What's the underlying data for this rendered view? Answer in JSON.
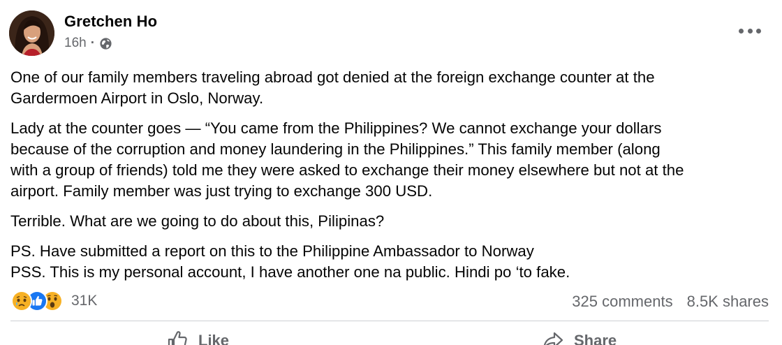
{
  "post": {
    "author": "Gretchen Ho",
    "time": "16h",
    "separator": "·",
    "privacy_icon": "globe-icon",
    "menu_icon": "more-horizontal-icon",
    "paragraphs": [
      "One of our family members traveling abroad got denied at the foreign exchange counter at the\nGardermoen Airport in Oslo, Norway.",
      "Lady at the counter goes — “You came from the Philippines? We cannot exchange your dollars\nbecause of the corruption and money laundering in the Philippines.” This family member (along\nwith a group of friends) told me they were asked to exchange their money elsewhere but not at the\nairport. Family member was just trying to exchange 300 USD.",
      "Terrible. What are we going to do about this, Pilipinas?",
      "PS. Have submitted a report on this to the Philippine Ambassador to Norway\nPSS. This is my personal account, I have another one na public. Hindi po ‘to fake."
    ]
  },
  "footer": {
    "reactions": [
      "sad-reaction-icon",
      "like-reaction-icon",
      "wow-reaction-icon"
    ],
    "reaction_count": "31K",
    "comments": "325 comments",
    "shares": "8.5K shares"
  },
  "actions": {
    "like": "Like",
    "share": "Share"
  },
  "colors": {
    "text": "#050505",
    "muted": "#65676b",
    "like_blue": "#1877f2",
    "reaction_yellow": "#f7b125"
  }
}
